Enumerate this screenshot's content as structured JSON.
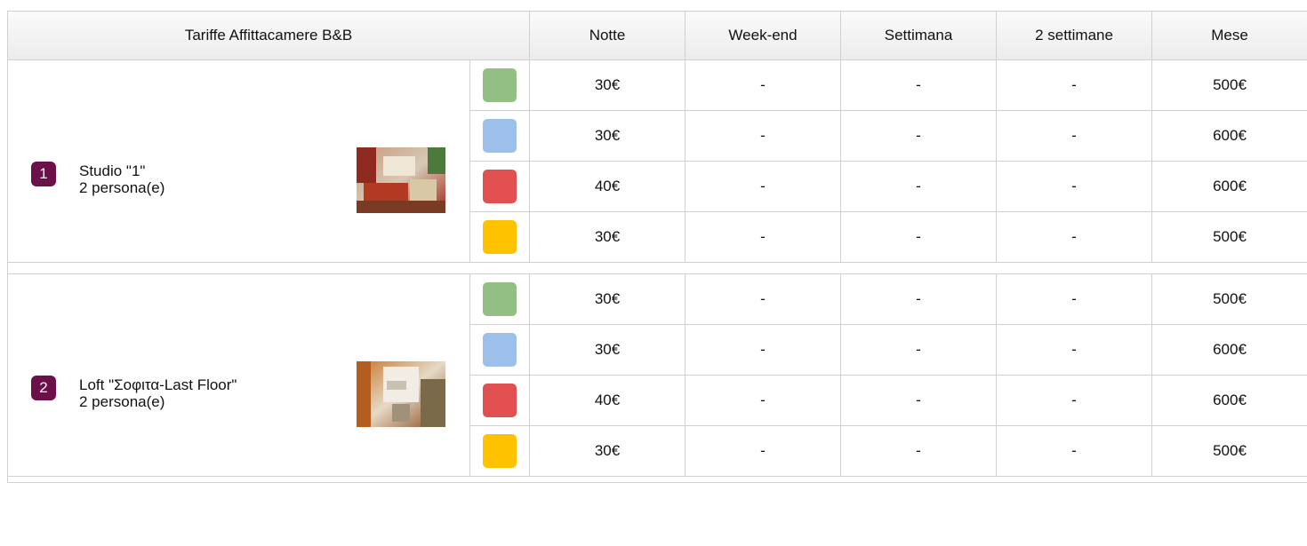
{
  "header": {
    "title": "Tariffe Affittacamere B&B",
    "cols": [
      "Notte",
      "Week-end",
      "Settimana",
      "2 settimane",
      "Mese"
    ]
  },
  "colors": {
    "green": "#93bf84",
    "blue": "#9dc0ea",
    "red": "#e05050",
    "yellow": "#ffc200",
    "badge": "#6b1048"
  },
  "rooms": [
    {
      "number": "1",
      "name": "Studio \"1\"",
      "capacity": "2 persona(e)",
      "photo": "room-photo-icon",
      "rows": [
        {
          "color": "green",
          "notte": "30€",
          "weekend": "-",
          "settimana": "-",
          "due_settimane": "-",
          "mese": "500€"
        },
        {
          "color": "blue",
          "notte": "30€",
          "weekend": "-",
          "settimana": "-",
          "due_settimane": "-",
          "mese": "600€"
        },
        {
          "color": "red",
          "notte": "40€",
          "weekend": "-",
          "settimana": "-",
          "due_settimane": "-",
          "mese": "600€"
        },
        {
          "color": "yellow",
          "notte": "30€",
          "weekend": "-",
          "settimana": "-",
          "due_settimane": "-",
          "mese": "500€"
        }
      ]
    },
    {
      "number": "2",
      "name": "Loft \"Σοφιτα-Last Floor\"",
      "capacity": "2 persona(e)",
      "photo": "loft-photo-icon",
      "rows": [
        {
          "color": "green",
          "notte": "30€",
          "weekend": "-",
          "settimana": "-",
          "due_settimane": "-",
          "mese": "500€"
        },
        {
          "color": "blue",
          "notte": "30€",
          "weekend": "-",
          "settimana": "-",
          "due_settimane": "-",
          "mese": "600€"
        },
        {
          "color": "red",
          "notte": "40€",
          "weekend": "-",
          "settimana": "-",
          "due_settimane": "-",
          "mese": "600€"
        },
        {
          "color": "yellow",
          "notte": "30€",
          "weekend": "-",
          "settimana": "-",
          "due_settimane": "-",
          "mese": "500€"
        }
      ]
    }
  ]
}
